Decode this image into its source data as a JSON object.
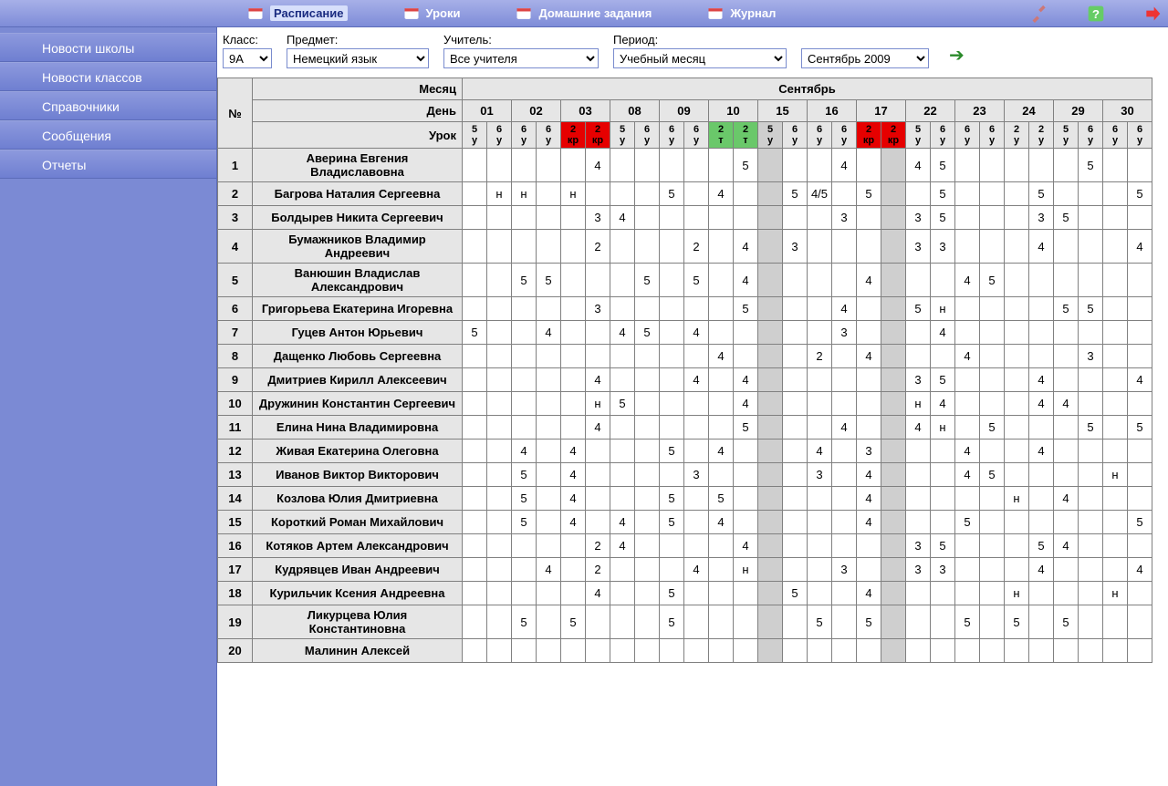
{
  "topbar": {
    "tabs": [
      {
        "label": "Расписание",
        "icon": "schedule-icon",
        "active": true
      },
      {
        "label": "Уроки",
        "icon": "lessons-icon",
        "active": false
      },
      {
        "label": "Домашние задания",
        "icon": "homework-icon",
        "active": false
      },
      {
        "label": "Журнал",
        "icon": "journal-icon",
        "active": false
      }
    ],
    "right_icons": [
      "tools-icon",
      "help-icon",
      "forward-icon"
    ]
  },
  "sidebar": {
    "items": [
      {
        "label": "Новости школы"
      },
      {
        "label": "Новости классов"
      },
      {
        "label": "Справочники"
      },
      {
        "label": "Сообщения"
      },
      {
        "label": "Отчеты"
      }
    ]
  },
  "filters": {
    "class_label": "Класс:",
    "class_value": "9А",
    "subject_label": "Предмет:",
    "subject_value": "Немецкий язык",
    "teacher_label": "Учитель:",
    "teacher_value": "Все учителя",
    "period_label": "Период:",
    "period_value": "Учебный месяц",
    "month_value": "Сентябрь 2009"
  },
  "grid": {
    "row_num_label": "№",
    "month_label": "Месяц",
    "month_value": "Сентябрь",
    "day_label": "День",
    "lesson_label": "Урок",
    "days": [
      "01",
      "02",
      "03",
      "08",
      "09",
      "10",
      "15",
      "16",
      "17",
      "22",
      "23",
      "24",
      "29",
      "30"
    ],
    "lessons": [
      {
        "n": "5",
        "s": "у",
        "t": "default"
      },
      {
        "n": "6",
        "s": "у",
        "t": "default"
      },
      {
        "n": "6",
        "s": "у",
        "t": "default"
      },
      {
        "n": "6",
        "s": "у",
        "t": "default"
      },
      {
        "n": "2",
        "s": "кр",
        "t": "red"
      },
      {
        "n": "2",
        "s": "кр",
        "t": "red"
      },
      {
        "n": "5",
        "s": "у",
        "t": "default"
      },
      {
        "n": "6",
        "s": "у",
        "t": "default"
      },
      {
        "n": "6",
        "s": "у",
        "t": "default"
      },
      {
        "n": "6",
        "s": "у",
        "t": "default"
      },
      {
        "n": "2",
        "s": "т",
        "t": "green"
      },
      {
        "n": "2",
        "s": "т",
        "t": "green"
      },
      {
        "n": "5",
        "s": "у",
        "t": "default"
      },
      {
        "n": "6",
        "s": "у",
        "t": "default"
      },
      {
        "n": "6",
        "s": "у",
        "t": "default"
      },
      {
        "n": "6",
        "s": "у",
        "t": "default"
      },
      {
        "n": "2",
        "s": "кр",
        "t": "red"
      },
      {
        "n": "2",
        "s": "кр",
        "t": "red"
      },
      {
        "n": "5",
        "s": "у",
        "t": "default"
      },
      {
        "n": "6",
        "s": "у",
        "t": "default"
      },
      {
        "n": "6",
        "s": "у",
        "t": "default"
      },
      {
        "n": "6",
        "s": "у",
        "t": "default"
      },
      {
        "n": "2",
        "s": "у",
        "t": "default"
      },
      {
        "n": "2",
        "s": "у",
        "t": "default"
      },
      {
        "n": "5",
        "s": "у",
        "t": "default"
      },
      {
        "n": "6",
        "s": "у",
        "t": "default"
      },
      {
        "n": "6",
        "s": "у",
        "t": "default"
      },
      {
        "n": "6",
        "s": "у",
        "t": "default"
      }
    ],
    "gray_cols": [
      12,
      17
    ],
    "students": [
      {
        "num": 1,
        "name": "Аверина Евгения Владиславовна",
        "marks": {
          "5": "4",
          "11": "5",
          "15": "4",
          "18": "4",
          "19": "5",
          "25": "5"
        }
      },
      {
        "num": 2,
        "name": "Багрова Наталия Сергеевна",
        "marks": {
          "1": "н",
          "2": "н",
          "4": "н",
          "8": "5",
          "10": "4",
          "13": "5",
          "14": "4/5",
          "16": "5",
          "19": "5",
          "23": "5",
          "27": "5"
        }
      },
      {
        "num": 3,
        "name": "Болдырев Никита Сергеевич",
        "marks": {
          "5": "3",
          "6": "4",
          "15": "3",
          "18": "3",
          "19": "5",
          "23": "3",
          "24": "5"
        }
      },
      {
        "num": 4,
        "name": "Бумажников Владимир Андреевич",
        "marks": {
          "5": "2",
          "9": "2",
          "11": "4",
          "13": "3",
          "18": "3",
          "19": "3",
          "23": "4",
          "27": "4"
        }
      },
      {
        "num": 5,
        "name": "Ванюшин Владислав Александрович",
        "marks": {
          "2": "5",
          "3": "5",
          "7": "5",
          "9": "5",
          "11": "4",
          "16": "4",
          "20": "4",
          "21": "5"
        },
        "sep": true
      },
      {
        "num": 6,
        "name": "Григорьева Екатерина Игоревна",
        "marks": {
          "5": "3",
          "11": "5",
          "15": "4",
          "18": "5",
          "19": "н",
          "24": "5",
          "25": "5"
        }
      },
      {
        "num": 7,
        "name": "Гуцев Антон Юрьевич",
        "marks": {
          "0": "5",
          "3": "4",
          "6": "4",
          "7": "5",
          "9": "4",
          "15": "3",
          "19": "4"
        }
      },
      {
        "num": 8,
        "name": "Дащенко Любовь Сергеевна",
        "marks": {
          "10": "4",
          "14": "2",
          "16": "4",
          "20": "4",
          "25": "3"
        }
      },
      {
        "num": 9,
        "name": "Дмитриев Кирилл Алексеевич",
        "marks": {
          "5": "4",
          "9": "4",
          "11": "4",
          "18": "3",
          "19": "5",
          "23": "4",
          "27": "4"
        }
      },
      {
        "num": 10,
        "name": "Дружинин Константин Сергеевич",
        "marks": {
          "5": "н",
          "6": "5",
          "11": "4",
          "18": "н",
          "19": "4",
          "23": "4",
          "24": "4"
        },
        "sep": true
      },
      {
        "num": 11,
        "name": "Елина Нина Владимировна",
        "marks": {
          "5": "4",
          "11": "5",
          "15": "4",
          "18": "4",
          "19": "н",
          "21": "5",
          "25": "5",
          "27": "5"
        }
      },
      {
        "num": 12,
        "name": "Живая Екатерина Олеговна",
        "marks": {
          "2": "4",
          "4": "4",
          "8": "5",
          "10": "4",
          "14": "4",
          "16": "3",
          "20": "4",
          "23": "4"
        }
      },
      {
        "num": 13,
        "name": "Иванов Виктор Викторович",
        "marks": {
          "2": "5",
          "4": "4",
          "9": "3",
          "14": "3",
          "16": "4",
          "20": "4",
          "21": "5",
          "26": "н"
        }
      },
      {
        "num": 14,
        "name": "Козлова Юлия Дмитриевна",
        "marks": {
          "2": "5",
          "4": "4",
          "8": "5",
          "10": "5",
          "16": "4",
          "22": "н",
          "24": "4"
        }
      },
      {
        "num": 15,
        "name": "Короткий Роман Михайлович",
        "marks": {
          "2": "5",
          "4": "4",
          "6": "4",
          "8": "5",
          "10": "4",
          "16": "4",
          "20": "5",
          "27": "5"
        },
        "sep": true
      },
      {
        "num": 16,
        "name": "Котяков Артем Александрович",
        "marks": {
          "5": "2",
          "6": "4",
          "11": "4",
          "18": "3",
          "19": "5",
          "23": "5",
          "24": "4"
        }
      },
      {
        "num": 17,
        "name": "Кудрявцев Иван Андреевич",
        "marks": {
          "3": "4",
          "5": "2",
          "9": "4",
          "11": "н",
          "15": "3",
          "18": "3",
          "19": "3",
          "23": "4",
          "27": "4"
        }
      },
      {
        "num": 18,
        "name": "Курильчик Ксения Андреевна",
        "marks": {
          "5": "4",
          "8": "5",
          "13": "5",
          "16": "4",
          "22": "н",
          "26": "н"
        }
      },
      {
        "num": 19,
        "name": "Ликурцева Юлия Константиновна",
        "marks": {
          "2": "5",
          "4": "5",
          "8": "5",
          "14": "5",
          "16": "5",
          "20": "5",
          "22": "5",
          "24": "5"
        }
      },
      {
        "num": 20,
        "name": "Малинин Алексей",
        "marks": {}
      }
    ]
  }
}
